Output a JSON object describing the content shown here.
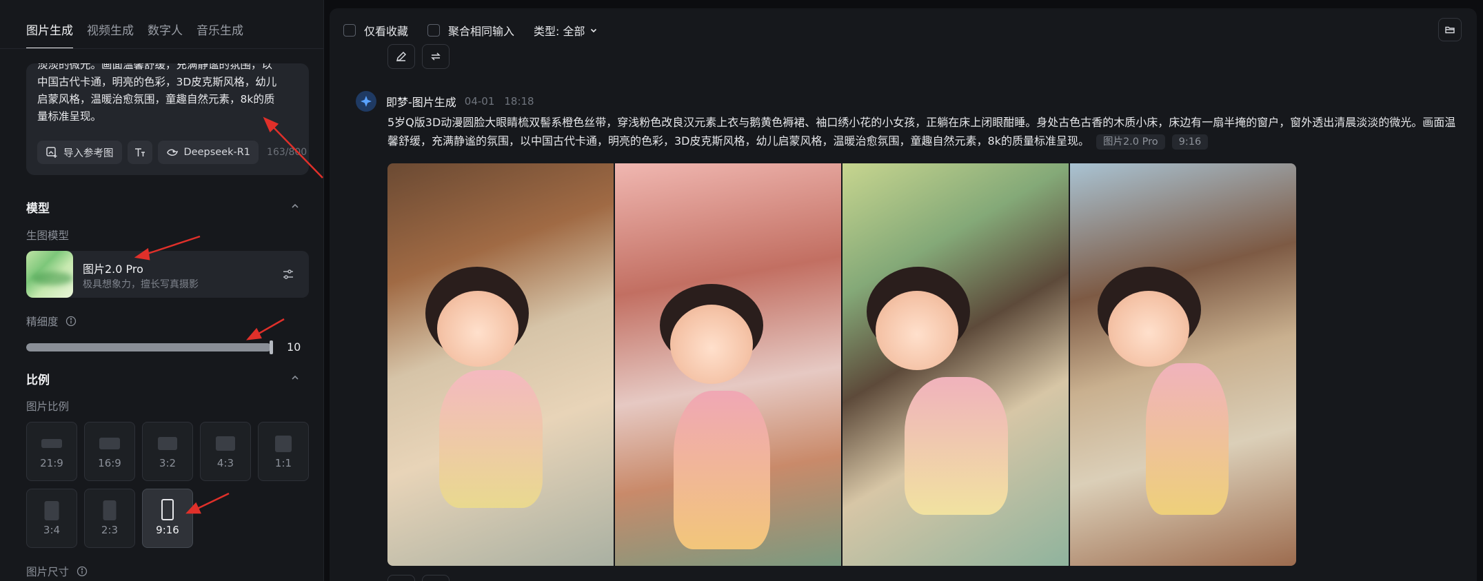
{
  "left": {
    "tabs": [
      {
        "label": "图片生成",
        "active": true
      },
      {
        "label": "视频生成",
        "active": false
      },
      {
        "label": "数字人",
        "active": false
      },
      {
        "label": "音乐生成",
        "active": false
      }
    ],
    "prompt": {
      "lines": [
        "淡淡的微光。画面温馨舒缓，充满静谧的氛围，以",
        "中国古代卡通，明亮的色彩，3D皮克斯风格，幼儿",
        "启蒙风格，温暖治愈氛围，童趣自然元素，8k的质",
        "量标准呈现。"
      ],
      "import_ref_label": "导入参考图",
      "model_label": "Deepseek-R1",
      "char_count": "163/800"
    },
    "model_section": {
      "title": "模型",
      "sub_label": "生图模型",
      "model_name": "图片2.0 Pro",
      "model_desc": "极具想象力，擅长写真摄影"
    },
    "detail": {
      "label": "精细度",
      "value": "10",
      "fill_fraction": 1.0
    },
    "ratio_section": {
      "title": "比例",
      "sub_label": "图片比例",
      "options": [
        {
          "label": "21:9",
          "active": false
        },
        {
          "label": "16:9",
          "active": false
        },
        {
          "label": "3:2",
          "active": false
        },
        {
          "label": "4:3",
          "active": false
        },
        {
          "label": "1:1",
          "active": false
        },
        {
          "label": "3:4",
          "active": false
        },
        {
          "label": "2:3",
          "active": false
        },
        {
          "label": "9:16",
          "active": true
        }
      ]
    },
    "size_label": "图片尺寸"
  },
  "right": {
    "filters": {
      "only_favorites": "仅看收藏",
      "merge_same_input": "聚合相同输入",
      "type_label": "类型: 全部"
    },
    "generation": {
      "title": "即梦-图片生成",
      "date": "04-01",
      "time": "18:18",
      "description": "5岁Q版3D动漫圆脸大眼睛梳双髻系橙色丝带，穿浅粉色改良汉元素上衣与鹅黄色褥裙、袖口绣小花的小女孩，正躺在床上闭眼酣睡。身处古色古香的木质小床，床边有一扇半掩的窗户，窗外透出清晨淡淡的微光。画面温馨舒缓，充满静谧的氛围，以中国古代卡通，明亮的色彩，3D皮克斯风格，幼儿启蒙风格，温暖治愈氛围，童趣自然元素，8k的质量标准呈现。",
      "chip_model": "图片2.0 Pro",
      "chip_ratio": "9:16",
      "image_count": 4
    }
  },
  "colors": {
    "background": "#0c0d10",
    "panel": "#16181c",
    "annotation_arrow": "#e0302a"
  }
}
